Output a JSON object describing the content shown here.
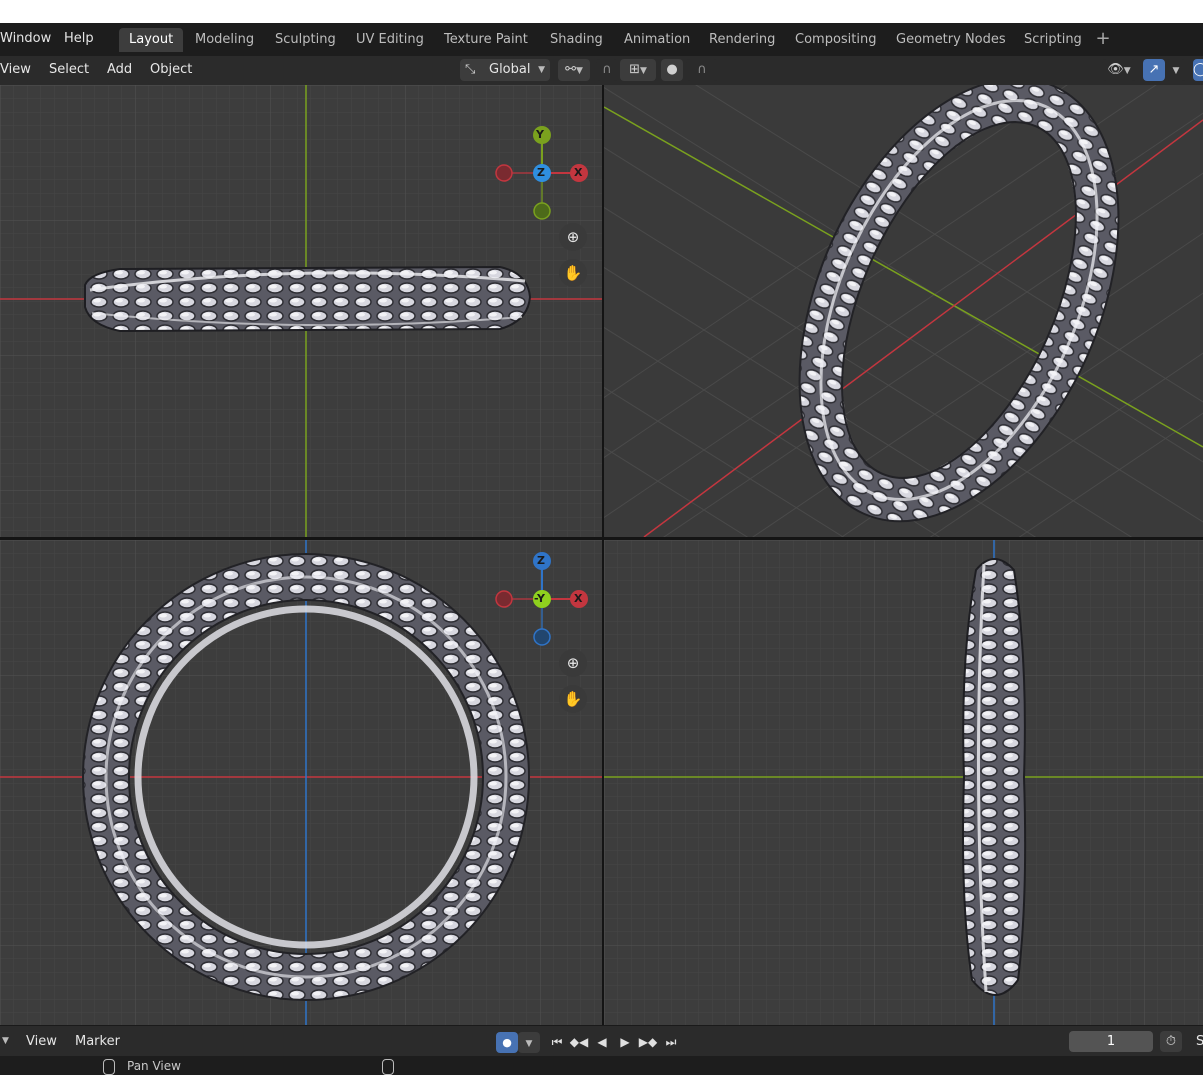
{
  "topbar": {
    "menus": [
      "Window",
      "Help"
    ],
    "workspaces": [
      "Layout",
      "Modeling",
      "Sculpting",
      "UV Editing",
      "Texture Paint",
      "Shading",
      "Animation",
      "Rendering",
      "Compositing",
      "Geometry Nodes",
      "Scripting"
    ],
    "active_workspace": "Layout",
    "add_workspace": "+"
  },
  "viewport_header": {
    "menus": [
      "View",
      "Select",
      "Add",
      "Object"
    ],
    "transform_orientation": "Global"
  },
  "gizmo": {
    "top_left": {
      "up": "Y",
      "center": "Z",
      "right": "X"
    },
    "bottom_left": {
      "up": "Z",
      "center": "-Y",
      "right": "X"
    }
  },
  "timeline": {
    "menus": [
      "View",
      "Marker"
    ],
    "current_frame": "1",
    "cut_label": "S"
  },
  "status": {
    "hint": "Pan View"
  },
  "colors": {
    "axis_x": "#c3363f",
    "axis_y": "#7aa11e",
    "axis_z": "#2f74c8",
    "grid_bg": "#3d3d3d",
    "persp_bg": "#3a3a3a"
  }
}
